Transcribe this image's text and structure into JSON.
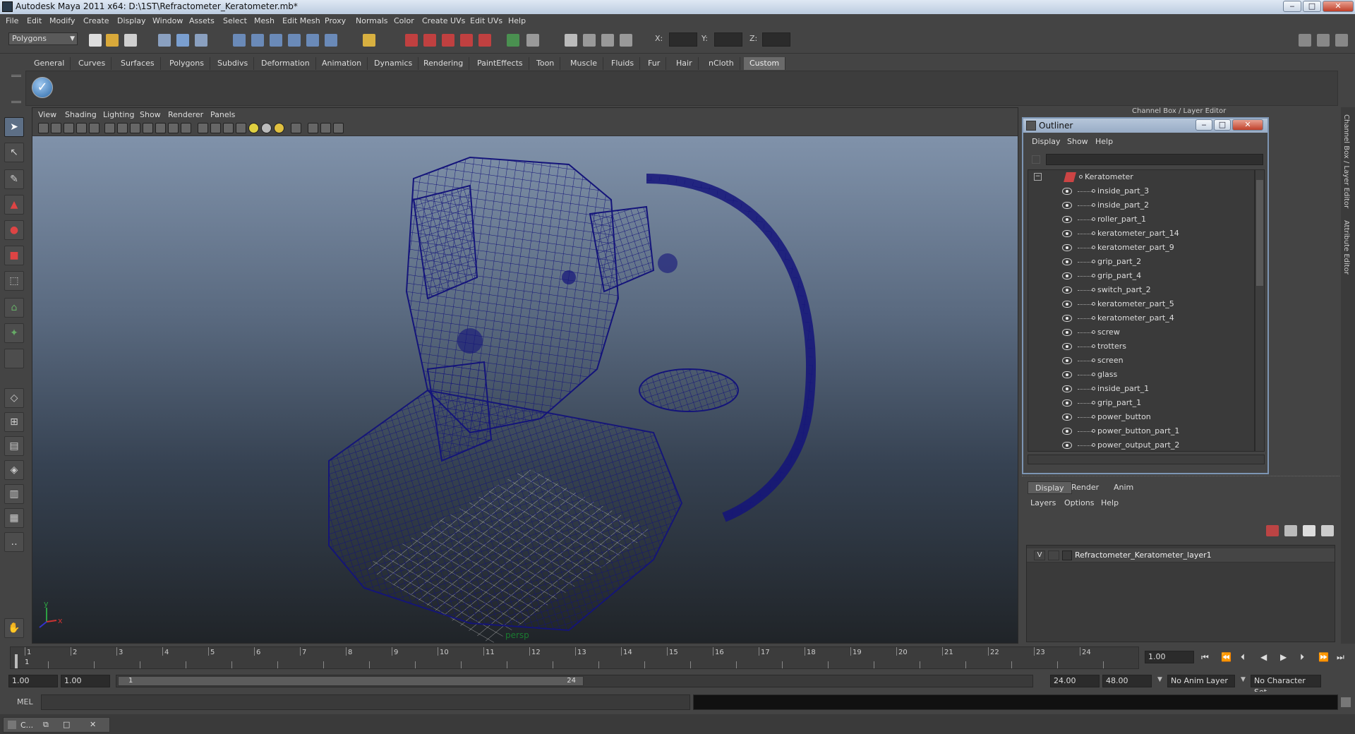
{
  "window": {
    "title": "Autodesk Maya 2011 x64: D:\\1ST\\Refractometer_Keratometer.mb*",
    "minimize": "‒",
    "maximize": "□",
    "close": "✕"
  },
  "menubar": [
    "File",
    "Edit",
    "Modify",
    "Create",
    "Display",
    "Window",
    "Assets",
    "Select",
    "Mesh",
    "Edit Mesh",
    "Proxy",
    "Normals",
    "Color",
    "Create UVs",
    "Edit UVs",
    "Help"
  ],
  "statusline": {
    "mode": "Polygons",
    "x_label": "X:",
    "y_label": "Y:",
    "z_label": "Z:"
  },
  "shelf": {
    "tabs": [
      "General",
      "Curves",
      "Surfaces",
      "Polygons",
      "Subdivs",
      "Deformation",
      "Animation",
      "Dynamics",
      "Rendering",
      "PaintEffects",
      "Toon",
      "Muscle",
      "Fluids",
      "Fur",
      "Hair",
      "nCloth",
      "Custom"
    ],
    "active_tab": "Custom"
  },
  "viewport": {
    "menu": [
      "View",
      "Shading",
      "Lighting",
      "Show",
      "Renderer",
      "Panels"
    ],
    "camera": "persp",
    "axis_x": "x",
    "axis_y": "y",
    "wire_color": "#14147a"
  },
  "outliner": {
    "title": "Outliner",
    "menu": [
      "Display",
      "Show",
      "Help"
    ],
    "root": "Keratometer",
    "items": [
      "inside_part_3",
      "inside_part_2",
      "roller_part_1",
      "keratometer_part_14",
      "keratometer_part_9",
      "grip_part_2",
      "grip_part_4",
      "switch_part_2",
      "keratometer_part_5",
      "keratometer_part_4",
      "screw",
      "trotters",
      "screen",
      "glass",
      "inside_part_1",
      "grip_part_1",
      "power_button",
      "power_button_part_1",
      "power_output_part_2"
    ]
  },
  "channelbox": {
    "title": "Channel Box / Layer Editor",
    "side_tabs": [
      "Channel Box / Layer Editor",
      "Attribute Editor"
    ]
  },
  "layers": {
    "tabs": [
      "Display",
      "Render",
      "Anim"
    ],
    "active_tab": "Display",
    "menu": [
      "Layers",
      "Options",
      "Help"
    ],
    "layer_visible": "V",
    "layer_name": "Refractometer_Keratometer_layer1"
  },
  "timeslider": {
    "ticks": [
      "1",
      "2",
      "3",
      "4",
      "5",
      "6",
      "7",
      "8",
      "9",
      "10",
      "11",
      "12",
      "13",
      "14",
      "15",
      "16",
      "17",
      "18",
      "19",
      "20",
      "21",
      "22",
      "23",
      "24"
    ],
    "current_frame": "1.00",
    "playhead": "1"
  },
  "range": {
    "start": "1.00",
    "anim_start": "1.00",
    "range_start": "1",
    "range_end": "24",
    "anim_end": "24.00",
    "end": "48.00",
    "anim_layer": "No Anim Layer",
    "char_set": "No Character Set"
  },
  "cmdline": {
    "label": "MEL"
  },
  "taskbar": {
    "item": "C..."
  }
}
